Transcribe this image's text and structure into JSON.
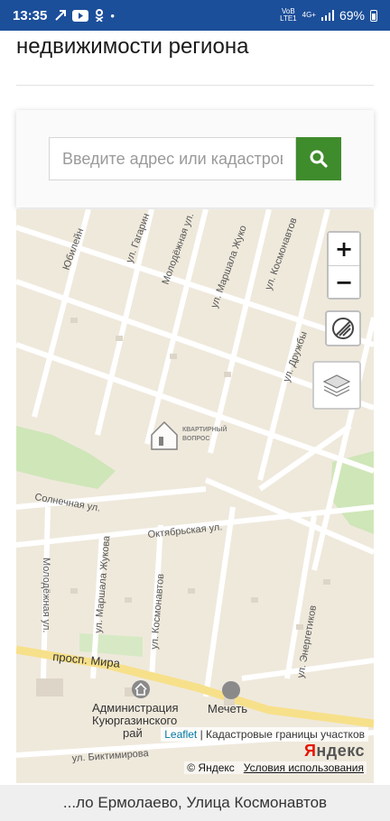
{
  "status_bar": {
    "time": "13:35",
    "net_top": "VoB",
    "net_mid": "LTE1",
    "net_gen": "4G+",
    "battery": "69%"
  },
  "header": {
    "title": "недвижимости региона"
  },
  "search": {
    "placeholder": "Введите адрес или кадастровый номер"
  },
  "map": {
    "zoom_in": "+",
    "zoom_out": "−",
    "streets": {
      "yubileynaya": "Юбилейн",
      "gagarina": "ул. Гагарин",
      "molodezhnaya_top": "Молодёжная ул.",
      "marshala_zhukova_top": "ул. Маршала Жуко",
      "kosmonavtov_top": "ул. Космонавтов",
      "druzhby": "ул. Дружбы",
      "solnechnaya": "Солнечная ул.",
      "oktyabrskaya": "Октябрьская ул.",
      "molodezhnaya_bottom": "Молодёжная ул.",
      "marshala_zhukova_bottom": "ул. Маршала Жукова",
      "kosmonavtov_bottom": "ул. Космонавтов",
      "energetikov": "ул. Энергетиков",
      "prospekt_mira": "просп. Мира",
      "biktimirova": "ул. Биктимирова"
    },
    "poi": {
      "administration_1": "Администрация",
      "administration_2": "Куюргазинского",
      "administration_3": "рай",
      "mosque": "Мечеть"
    },
    "watermark_1": "КВАРТИРНЫЙ",
    "watermark_2": "ВОПРОС",
    "attribution_leaflet": "Leaflet",
    "attribution_rest": "| Кадастровые границы участков",
    "yandex_logo_y": "Я",
    "yandex_logo_rest": "ндекс",
    "yandex_copy": "© Яндекс",
    "yandex_terms": "Условия использования"
  },
  "bottom": {
    "address": "...ло Ермолаево, Улица Космонавтов"
  },
  "colors": {
    "status_bar": "#1c4f9a",
    "search_button": "#3f8c2c",
    "map_bg": "#efe9dc",
    "park": "#cfe6b8"
  }
}
